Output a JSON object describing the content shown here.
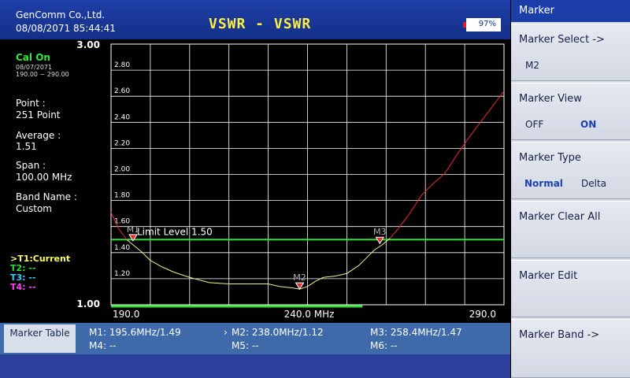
{
  "header": {
    "company": "GenComm Co.,Ltd.",
    "datetime": "08/08/2071 85:44:41",
    "title": "VSWR - VSWR",
    "battery": "97%",
    "battery_level": 0.97
  },
  "info": {
    "cal_status": "Cal On",
    "cal_date": "08/07/2071",
    "cal_range": "190.00 ~ 290.00",
    "point_label": "Point :",
    "point_value": "251 Point",
    "average_label": "Average :",
    "average_value": "1.51",
    "span_label": "Span :",
    "span_value": "100.00 MHz",
    "band_label": "Band Name :",
    "band_value": "Custom"
  },
  "traces": [
    {
      "label": ">T1:Current",
      "color": "#ffff66"
    },
    {
      "label": "T2: --",
      "color": "#33dd33"
    },
    {
      "label": "T3: --",
      "color": "#33ccff"
    },
    {
      "label": "T4: --",
      "color": "#ff44ff"
    }
  ],
  "chart_data": {
    "type": "line",
    "x_min": 190.0,
    "x_max": 290.0,
    "y_min": 1.0,
    "y_max": 3.0,
    "y_ticks": [
      "2.80",
      "2.60",
      "2.40",
      "2.20",
      "2.00",
      "1.80",
      "1.60",
      "1.40",
      "1.20"
    ],
    "y_tick_values": [
      2.8,
      2.6,
      2.4,
      2.2,
      2.0,
      1.8,
      1.6,
      1.4,
      1.2
    ],
    "y_max_label": "3.00",
    "y_min_label": "1.00",
    "x_tick_labels": [
      "190.0",
      "240.0 MHz",
      "290.0"
    ],
    "grid": true,
    "limit_line": {
      "value": 1.5,
      "label": "Limit Level 1.50",
      "color": "#33dd33"
    },
    "series": [
      {
        "color": "#f0f090",
        "over_limit_color": "#e03030",
        "x": [
          190.0,
          192.0,
          194.0,
          196.0,
          198.0,
          200.0,
          203.0,
          206.0,
          210.0,
          215.0,
          220.0,
          225.0,
          230.0,
          233.0,
          236.0,
          238.0,
          240.0,
          242.0,
          244.0,
          247.0,
          250.0,
          253.0,
          255.0,
          257.0,
          259.0,
          261.0,
          263.0,
          266.0,
          269.0,
          272.0,
          275.0,
          278.0,
          281.0,
          284.0,
          287.0,
          290.0
        ],
        "y": [
          1.71,
          1.58,
          1.5,
          1.45,
          1.4,
          1.34,
          1.29,
          1.25,
          1.21,
          1.17,
          1.16,
          1.16,
          1.16,
          1.14,
          1.13,
          1.12,
          1.14,
          1.18,
          1.21,
          1.22,
          1.24,
          1.3,
          1.36,
          1.42,
          1.46,
          1.51,
          1.58,
          1.7,
          1.84,
          1.93,
          2.01,
          2.15,
          2.28,
          2.4,
          2.52,
          2.64
        ]
      }
    ],
    "markers": [
      {
        "label": "M1",
        "x": 195.6,
        "y": 1.49
      },
      {
        "label": "M2",
        "x": 238.0,
        "y": 1.12
      },
      {
        "label": "M3",
        "x": 258.4,
        "y": 1.47
      }
    ],
    "band_bar": {
      "x_start": 190.0,
      "x_end": 254.0,
      "color": "#33dd33"
    }
  },
  "marker_table": {
    "label": "Marker Table",
    "cells": [
      {
        "text": "M1: 195.6MHz/1.49"
      },
      {
        "text": "M2: 238.0MHz/1.12",
        "active": true
      },
      {
        "text": "M3: 258.4MHz/1.47"
      },
      {
        "text": "M4: --"
      },
      {
        "text": "M5: --"
      },
      {
        "text": "M6: --"
      }
    ]
  },
  "softkeys": {
    "header": "Marker",
    "buttons": [
      {
        "title": "Marker Select ->",
        "sub": [
          "M2"
        ],
        "sub_active": []
      },
      {
        "title": "Marker View",
        "sub": [
          "OFF",
          "ON"
        ],
        "sub_active": [
          1
        ]
      },
      {
        "title": "Marker Type",
        "sub": [
          "Normal",
          "Delta"
        ],
        "sub_active": [
          0
        ]
      },
      {
        "title": "Marker Clear All",
        "sub": [],
        "sub_active": []
      },
      {
        "title": "Marker Edit",
        "sub": [],
        "sub_active": []
      },
      {
        "title": "Marker Band ->",
        "sub": [],
        "sub_active": []
      }
    ]
  }
}
